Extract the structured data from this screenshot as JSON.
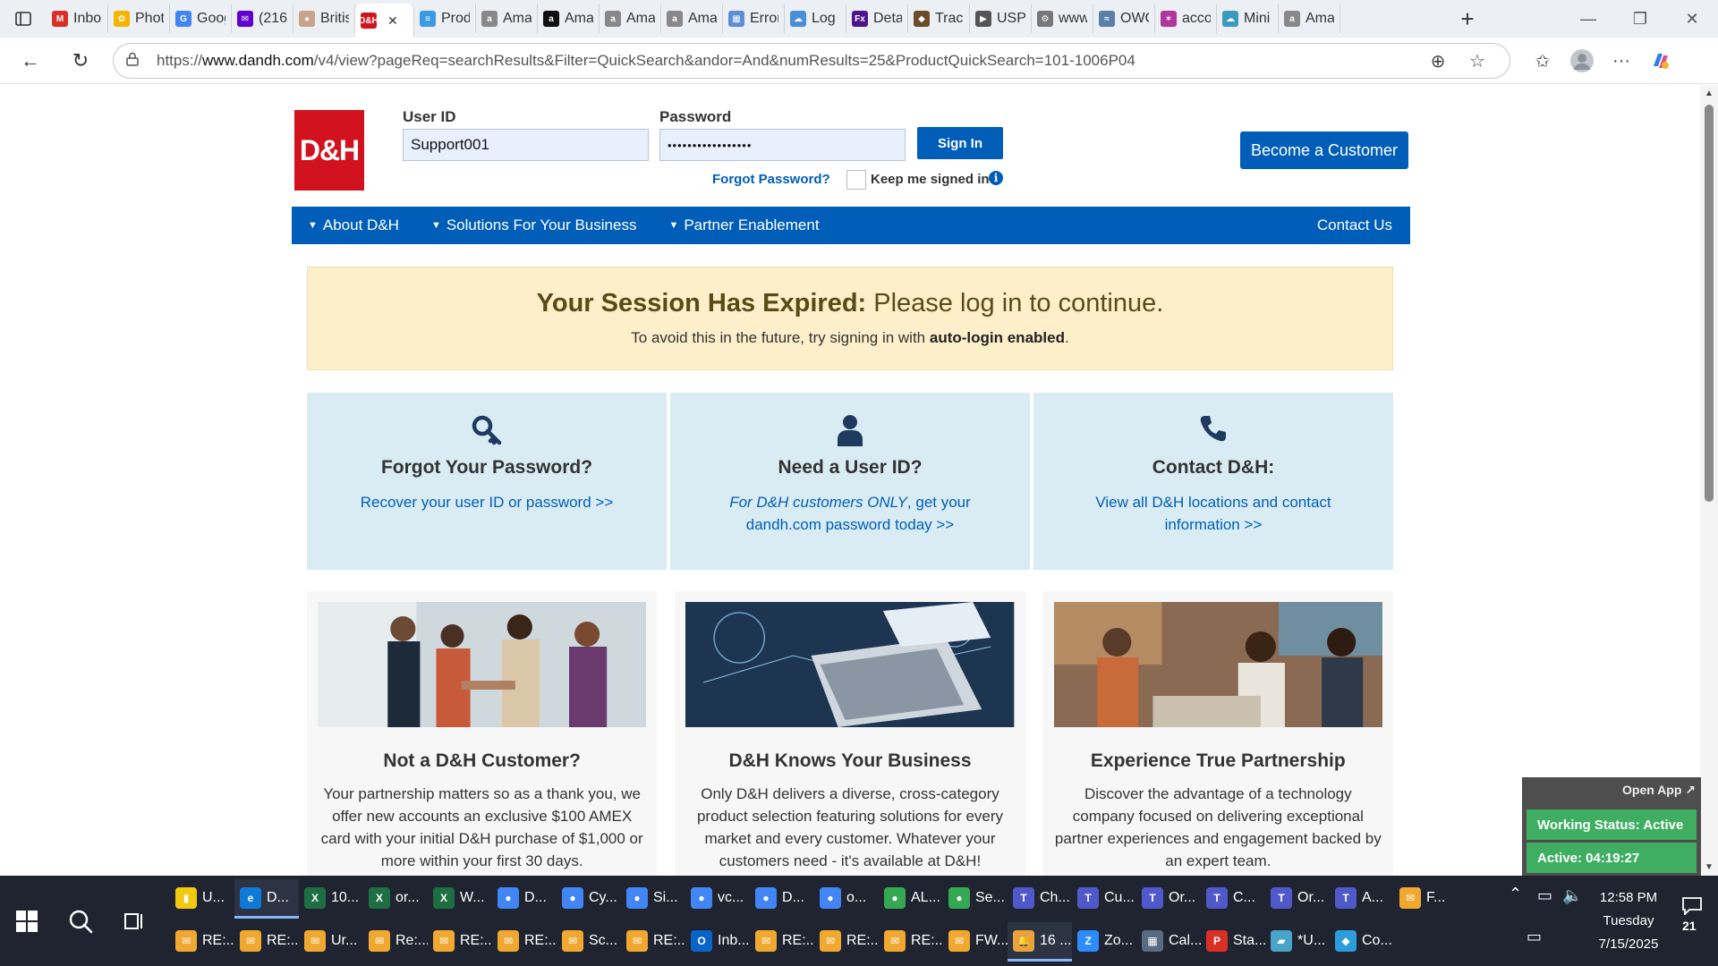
{
  "browser": {
    "tabs": [
      {
        "label": "Inbo",
        "color": "#d93025",
        "glyph": "M"
      },
      {
        "label": "Phot",
        "color": "#f4b400",
        "glyph": "✿"
      },
      {
        "label": "Goog",
        "color": "#4285f4",
        "glyph": "G"
      },
      {
        "label": "(216",
        "color": "#5f01d1",
        "glyph": "✉"
      },
      {
        "label": "Britis",
        "color": "#c9a38a",
        "glyph": "●"
      },
      {
        "label": "",
        "color": "#d3121f",
        "glyph": "D&H",
        "active": true
      },
      {
        "label": "Prod",
        "color": "#3b9ae1",
        "glyph": "≡"
      },
      {
        "label": "Ama",
        "color": "#888888",
        "glyph": "a"
      },
      {
        "label": "Ama",
        "color": "#111111",
        "glyph": "a"
      },
      {
        "label": "Ama",
        "color": "#888888",
        "glyph": "a"
      },
      {
        "label": "Ama",
        "color": "#888888",
        "glyph": "a"
      },
      {
        "label": "Error",
        "color": "#5b8dd9",
        "glyph": "▦"
      },
      {
        "label": "Log",
        "color": "#4a90d9",
        "glyph": "☁"
      },
      {
        "label": "Deta",
        "color": "#4d148c",
        "glyph": "Fx"
      },
      {
        "label": "Track",
        "color": "#6b4b2a",
        "glyph": "◆"
      },
      {
        "label": "USPS",
        "color": "#555555",
        "glyph": "▶"
      },
      {
        "label": "www",
        "color": "#777777",
        "glyph": "⚙"
      },
      {
        "label": "OWC",
        "color": "#5a7fa8",
        "glyph": "≈"
      },
      {
        "label": "acco",
        "color": "#b0359c",
        "glyph": "✶"
      },
      {
        "label": "Mini",
        "color": "#3a9bbf",
        "glyph": "☁"
      },
      {
        "label": "Ama",
        "color": "#888888",
        "glyph": "a"
      }
    ],
    "url_prefix": "https://",
    "url_domain": "www.dandh.com",
    "url_rest": "/v4/view?pageReq=searchResults&Filter=QuickSearch&andor=And&numResults=25&ProductQuickSearch=101-1006P04"
  },
  "login": {
    "user_id_label": "User ID",
    "user_id_value": "Support001",
    "password_label": "Password",
    "password_value": "•••••••••••••••••",
    "sign_in": "Sign In",
    "forgot": "Forgot Password?",
    "keep_signed_in": "Keep me signed in",
    "become_customer": "Become a Customer",
    "logo_text": "D&H"
  },
  "nav": {
    "items": [
      "About D&H",
      "Solutions For Your Business",
      "Partner Enablement"
    ],
    "contact": "Contact Us"
  },
  "alert": {
    "heading_bold": "Your Session Has Expired:",
    "heading_rest": " Please log in to continue.",
    "sub_pre": "To avoid this in the future, try signing in with ",
    "sub_bold": "auto-login enabled",
    "sub_post": "."
  },
  "help": [
    {
      "icon": "key-icon",
      "title": "Forgot Your Password?",
      "link_html_pre": "",
      "link_italic": "",
      "link_rest": "Recover your user ID or password >>"
    },
    {
      "icon": "user-icon",
      "title": "Need a User ID?",
      "link_italic": "For D&H customers ONLY",
      "link_rest": ", get your dandh.com password today >>"
    },
    {
      "icon": "phone-icon",
      "title": "Contact D&H:",
      "link_italic": "",
      "link_rest": "View all D&H locations and contact information >>"
    }
  ],
  "promos": [
    {
      "title": "Not a D&H Customer?",
      "body": "Your partnership matters so as a thank you, we offer new accounts an exclusive $100 AMEX card with your initial D&H purchase of $1,000 or more within your first 30 days."
    },
    {
      "title": "D&H Knows Your Business",
      "body": "Only D&H delivers a diverse, cross-category product selection featuring solutions for every market and every customer. Whatever your customers need - it's available at D&H!"
    },
    {
      "title": "Experience True Partnership",
      "body": "Discover the advantage of a technology company focused on delivering exceptional partner experiences and engagement backed by an expert team."
    }
  ],
  "widget": {
    "open_app": "Open App ↗",
    "working_status": "Working Status: Active",
    "active_timer": "Active: 04:19:27"
  },
  "taskbar": {
    "row1": [
      {
        "label": "U...",
        "color": "#f2c811",
        "glyph": "▮"
      },
      {
        "label": "D...",
        "color": "#0f7ad6",
        "glyph": "e",
        "active": true
      },
      {
        "label": "10...",
        "color": "#1d6f42",
        "glyph": "X"
      },
      {
        "label": "or...",
        "color": "#1d6f42",
        "glyph": "X"
      },
      {
        "label": "W...",
        "color": "#1d6f42",
        "glyph": "X"
      },
      {
        "label": "D...",
        "color": "#4285f4",
        "glyph": "●"
      },
      {
        "label": "Cy...",
        "color": "#4285f4",
        "glyph": "●"
      },
      {
        "label": "Si...",
        "color": "#4285f4",
        "glyph": "●"
      },
      {
        "label": "vc...",
        "color": "#4285f4",
        "glyph": "●"
      },
      {
        "label": "D...",
        "color": "#4285f4",
        "glyph": "●"
      },
      {
        "label": "o...",
        "color": "#4285f4",
        "glyph": "●"
      },
      {
        "label": "AL...",
        "color": "#34a853",
        "glyph": "●"
      },
      {
        "label": "Se...",
        "color": "#34a853",
        "glyph": "●"
      },
      {
        "label": "Ch...",
        "color": "#5059c9",
        "glyph": "T"
      },
      {
        "label": "Cu...",
        "color": "#5059c9",
        "glyph": "T"
      },
      {
        "label": "Or...",
        "color": "#5059c9",
        "glyph": "T"
      },
      {
        "label": "C...",
        "color": "#5059c9",
        "glyph": "T"
      },
      {
        "label": "Or...",
        "color": "#5059c9",
        "glyph": "T"
      },
      {
        "label": "A...",
        "color": "#5059c9",
        "glyph": "T"
      },
      {
        "label": "F...",
        "color": "#f0a830",
        "glyph": "✉"
      }
    ],
    "row2": [
      {
        "label": "RE:...",
        "color": "#f0a830",
        "glyph": "✉"
      },
      {
        "label": "RE:...",
        "color": "#f0a830",
        "glyph": "✉"
      },
      {
        "label": "Ur...",
        "color": "#f0a830",
        "glyph": "✉"
      },
      {
        "label": "Re:...",
        "color": "#f0a830",
        "glyph": "✉"
      },
      {
        "label": "RE:...",
        "color": "#f0a830",
        "glyph": "✉"
      },
      {
        "label": "RE:...",
        "color": "#f0a830",
        "glyph": "✉"
      },
      {
        "label": "Sc...",
        "color": "#f0a830",
        "glyph": "✉"
      },
      {
        "label": "RE:...",
        "color": "#f0a830",
        "glyph": "✉"
      },
      {
        "label": "Inb...",
        "color": "#0a64c8",
        "glyph": "O"
      },
      {
        "label": "RE:...",
        "color": "#f0a830",
        "glyph": "✉"
      },
      {
        "label": "RE:...",
        "color": "#f0a830",
        "glyph": "✉"
      },
      {
        "label": "RE:...",
        "color": "#f0a830",
        "glyph": "✉"
      },
      {
        "label": "FW...",
        "color": "#f0a830",
        "glyph": "✉"
      },
      {
        "label": "16 ...",
        "color": "#e8a33d",
        "glyph": "🔔",
        "active": true
      },
      {
        "label": "Zo...",
        "color": "#2d8cff",
        "glyph": "Z"
      },
      {
        "label": "Cal...",
        "color": "#5a6a80",
        "glyph": "▦"
      },
      {
        "label": "Sta...",
        "color": "#d93025",
        "glyph": "P"
      },
      {
        "label": "*U...",
        "color": "#4aa3c9",
        "glyph": "▰"
      },
      {
        "label": "Co...",
        "color": "#2d9cdb",
        "glyph": "◆"
      }
    ],
    "time": "12:58 PM",
    "day": "Tuesday",
    "date": "7/15/2025",
    "notif_count": "21"
  }
}
